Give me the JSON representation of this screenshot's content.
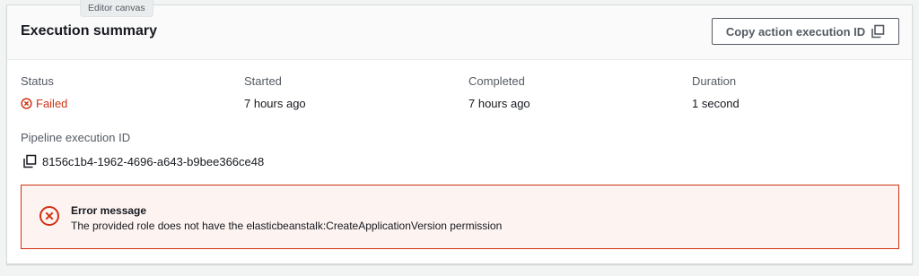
{
  "tooltip": {
    "label": "Editor canvas"
  },
  "card": {
    "title": "Execution summary",
    "copy_action_label": "Copy action execution ID"
  },
  "summary": {
    "status": {
      "label": "Status",
      "value": "Failed"
    },
    "started": {
      "label": "Started",
      "value": "7 hours ago"
    },
    "completed": {
      "label": "Completed",
      "value": "7 hours ago"
    },
    "duration": {
      "label": "Duration",
      "value": "1 second"
    }
  },
  "pipeline": {
    "label": "Pipeline execution ID",
    "id": "8156c1b4-1962-4696-a643-b9bee366ce48"
  },
  "error": {
    "title": "Error message",
    "message": "The provided role does not have the elasticbeanstalk:CreateApplicationVersion permission"
  },
  "colors": {
    "error_red": "#d13212",
    "alert_bg": "#fdf3f1",
    "label_gray": "#545b64",
    "text": "#16191f"
  },
  "icons": {
    "copy": "copy-icon",
    "status_failed": "status-failed-icon",
    "alert_error": "error-circle-icon"
  }
}
